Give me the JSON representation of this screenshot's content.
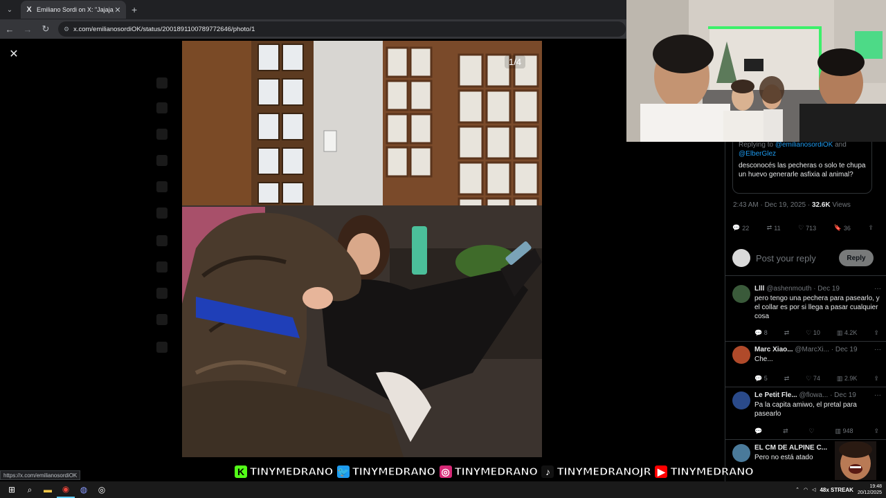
{
  "browser": {
    "tab_title": "Emiliano Sordi on X: \"Jajajaja ti",
    "tab_favicon": "X",
    "url": "x.com/emilianosordiOK/status/2001891100789772646/photo/1",
    "status_url": "https://x.com/emilianosordiOK"
  },
  "viewer": {
    "counter": "1/4",
    "close_icon": "close-icon"
  },
  "post": {
    "replying_to_prefix": "Replying to",
    "replying_to_1": "@emilianosordiOK",
    "replying_and": "and",
    "replying_to_2": "@ElberGlez",
    "quoted_text": "desconocés las pecheras o solo te chupa un huevo generarle asfixia al animal?",
    "time": "2:43 AM · Dec 19, 2025 ·",
    "views_count": "32.6K",
    "views_label": "Views",
    "replies": "22",
    "reposts": "11",
    "likes": "713",
    "bookmarks": "36",
    "reply_placeholder": "Post your reply",
    "reply_button": "Reply"
  },
  "replies": [
    {
      "name": "Llll",
      "handle": "@ashenmouth · Dec 19",
      "text": "pero tengo una pechera para pasearlo, y el collar es por si llega a pasar cualquier cosa",
      "replies": "8",
      "reposts": "",
      "likes": "10",
      "views": "4.2K",
      "avatar_color": "#3a5a3a"
    },
    {
      "name": "Marc Xiao...",
      "handle": "@MarcXi... · Dec 19",
      "text": "Che...",
      "replies": "5",
      "reposts": "",
      "likes": "74",
      "views": "2.9K",
      "avatar_color": "#b04a2a"
    },
    {
      "name": "Le Petit Fle...",
      "handle": "@flowa... · Dec 19",
      "text": "Pa la capita amiwo, el pretal para pasearlo",
      "replies": "",
      "reposts": "",
      "likes": "",
      "views": "948",
      "avatar_color": "#2a4a8a"
    },
    {
      "name": "EL CM DE ALPINE C...",
      "handle": "",
      "text": "Pero no está atado",
      "replies": "",
      "reposts": "",
      "likes": "",
      "views": "",
      "avatar_color": "#4a7a9a"
    }
  ],
  "banner": [
    {
      "icon": "K",
      "color": "#53fc18",
      "text": "TINYMEDRANO",
      "icon_name": "kick-icon"
    },
    {
      "icon": "🐦",
      "color": "#1d9bf0",
      "text": "TINYMEDRANO",
      "icon_name": "twitter-icon"
    },
    {
      "icon": "◎",
      "color": "#d62976",
      "text": "TINYMEDRANO",
      "icon_name": "instagram-icon"
    },
    {
      "icon": "♪",
      "color": "#111111",
      "text": "TINYMEDRANOJR",
      "icon_name": "tiktok-icon"
    },
    {
      "icon": "▶",
      "color": "#ff0000",
      "text": "TINYMEDRANO",
      "icon_name": "youtube-icon"
    }
  ],
  "overlay": {
    "streak_text": "48x STREAK"
  },
  "taskbar": {
    "time": "19:48",
    "date": "20/12/2025"
  }
}
